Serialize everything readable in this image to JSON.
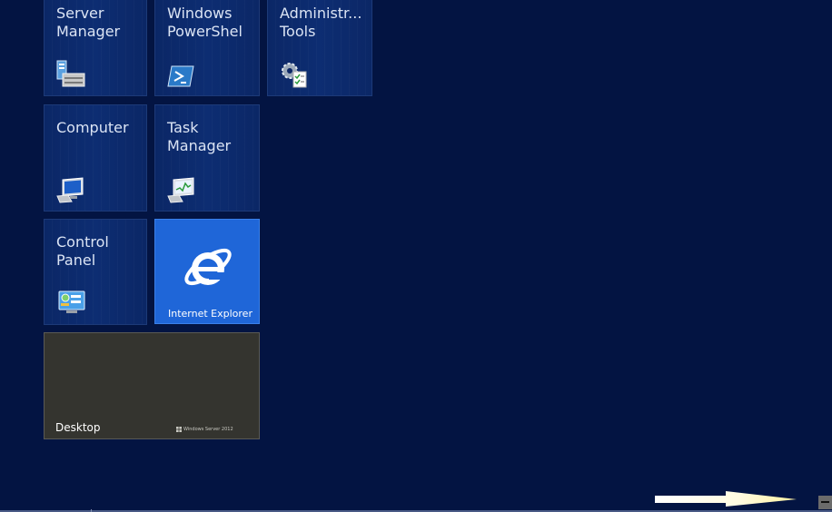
{
  "tiles": {
    "server_manager": {
      "label": "Server\nManager",
      "icon": "server-manager-icon"
    },
    "powershell": {
      "label": "Windows\nPowerShel",
      "icon": "powershell-icon"
    },
    "admin_tools": {
      "label": "Administr...\nTools",
      "icon": "admin-tools-icon"
    },
    "computer": {
      "label": "Computer",
      "icon": "computer-icon"
    },
    "task_manager": {
      "label": "Task\nManager",
      "icon": "task-manager-icon"
    },
    "control_panel": {
      "label": "Control\nPanel",
      "icon": "control-panel-icon"
    },
    "internet_explorer": {
      "label": "Internet Explorer",
      "icon": "internet-explorer-icon",
      "color": "#1f66d8"
    },
    "desktop": {
      "label": "Desktop",
      "brand": "Windows Server 2012",
      "color": "#34342f"
    }
  },
  "background_color": "#031442",
  "scroll": {
    "arrow_icon": "right-arrow-icon",
    "zoom_button_icon": "minus-icon"
  }
}
